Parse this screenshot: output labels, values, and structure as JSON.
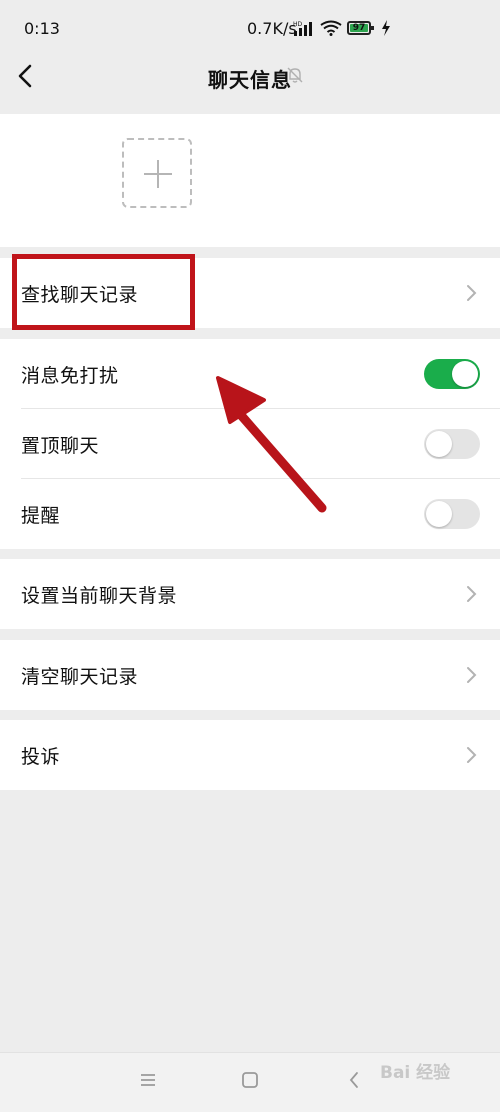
{
  "status_bar": {
    "time": "0:13",
    "speed": "0.7K/s",
    "battery": "97",
    "icons": [
      "hd-signal-icon",
      "wifi-icon",
      "battery-icon",
      "charging-icon"
    ]
  },
  "header": {
    "title": "聊天信息",
    "back_icon": "chevron-left-icon",
    "mute_icon": "bell-off-icon"
  },
  "members": {
    "add_icon": "plus-icon"
  },
  "rows": {
    "search_history": "查找聊天记录",
    "mute_notifications": "消息免打扰",
    "pin_chat": "置顶聊天",
    "reminder": "提醒",
    "set_background": "设置当前聊天背景",
    "clear_history": "清空聊天记录",
    "report": "投诉"
  },
  "toggles": {
    "mute_notifications": true,
    "pin_chat": false,
    "reminder": false
  },
  "colors": {
    "toggle_on": "#1aad4b",
    "toggle_off": "#e4e4e4",
    "annotation": "#c0141a",
    "background": "#ededed"
  },
  "watermark": {
    "text": "Bai 经验"
  }
}
